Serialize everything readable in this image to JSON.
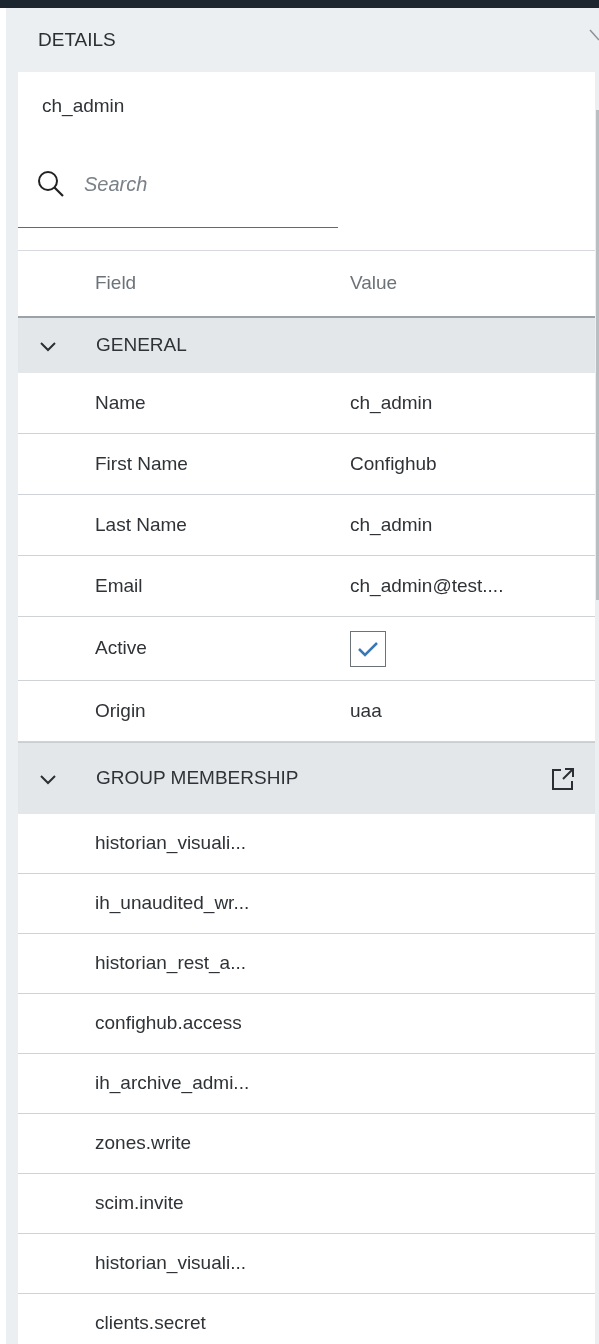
{
  "panel": {
    "title": "DETAILS",
    "user": "ch_admin",
    "search": {
      "placeholder": "Search"
    }
  },
  "table": {
    "columns": [
      "Field",
      "Value"
    ],
    "sections": [
      {
        "title": "GENERAL",
        "kind": "fields",
        "expanded": true,
        "rows": [
          {
            "field": "Name",
            "kind": "text",
            "value": "ch_admin"
          },
          {
            "field": "First Name",
            "kind": "text",
            "value": "Confighub"
          },
          {
            "field": "Last Name",
            "kind": "text",
            "value": "ch_admin"
          },
          {
            "field": "Email",
            "kind": "text",
            "value": "ch_admin@test...."
          },
          {
            "field": "Active",
            "kind": "checkbox",
            "checked": true
          },
          {
            "field": "Origin",
            "kind": "text",
            "value": "uaa"
          }
        ]
      },
      {
        "title": "GROUP MEMBERSHIP",
        "kind": "list",
        "expanded": true,
        "rows": [
          {
            "field": "historian_visuali..."
          },
          {
            "field": "ih_unaudited_wr..."
          },
          {
            "field": "historian_rest_a..."
          },
          {
            "field": "confighub.access"
          },
          {
            "field": "ih_archive_admi..."
          },
          {
            "field": "zones.write"
          },
          {
            "field": "scim.invite"
          },
          {
            "field": "historian_visuali..."
          },
          {
            "field": "clients.secret"
          }
        ]
      }
    ]
  }
}
